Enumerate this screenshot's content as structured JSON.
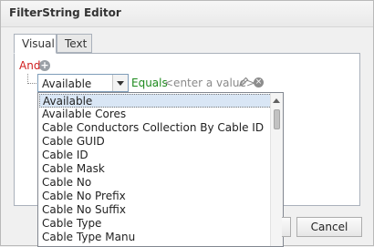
{
  "window": {
    "title": "FilterString Editor"
  },
  "tabs": [
    {
      "label": "Visual",
      "active": true
    },
    {
      "label": "Text",
      "active": false
    }
  ],
  "filter": {
    "group_operator": "And",
    "field_value": "Available",
    "operator": "Equals",
    "value_placeholder": "<enter a value>"
  },
  "dropdown": {
    "items": [
      "Available",
      "Available Cores",
      "Cable Conductors Collection By Cable ID",
      "Cable GUID",
      "Cable ID",
      "Cable Mask",
      "Cable No",
      "Cable No Prefix",
      "Cable No Suffix",
      "Cable Type",
      "Cable Type Manu"
    ],
    "selected_index": 0
  },
  "buttons": {
    "cancel": "Cancel"
  },
  "colors": {
    "and": "#d01e1e",
    "equals": "#1d8a1d",
    "placeholder": "#8a8a8a"
  }
}
